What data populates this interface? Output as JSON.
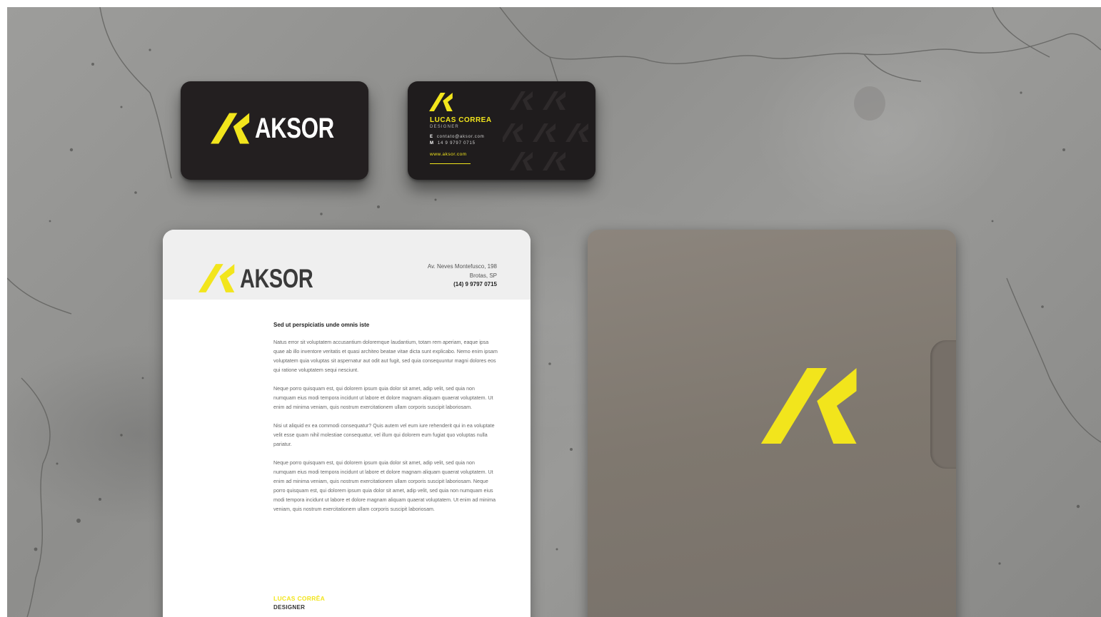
{
  "scene": {
    "background": "concrete-texture",
    "colors": {
      "brand_yellow": "#f2e51c",
      "card_black": "#231f20",
      "folder_taupe": "#7f786f",
      "letterhead_band": "#efefef"
    }
  },
  "business_card_front": {
    "logo_icon": "ak-monogram-icon",
    "wordmark": "AKSOR"
  },
  "business_card_back": {
    "logo_icon": "ak-monogram-icon",
    "name": "LUCAS CORREA",
    "title": "DESIGNER",
    "email_label": "E",
    "email": "contato@aksor.com",
    "mobile_label": "M",
    "mobile": "14 9 9797 0715",
    "website": "www.aksor.com"
  },
  "letterhead": {
    "wordmark": "AKSOR",
    "address_line1": "Av. Neves Montefusco, 198",
    "address_line2": "Brotas, SP",
    "phone": "(14) 9 9797 0715",
    "subject": "Sed ut perspiciatis unde omnis iste",
    "paragraphs": [
      "Natus error sit voluptatem accusantium doloremque laudantium, totam rem aperiam, eaque ipsa quae ab illo inventore veritatis et quasi architeo beatae vitae dicta sunt explicabo. Nemo enim ipsam voluptatem quia voluptas sit aspernatur aut odit aut fugit, sed quia consequuntur magni dolores eos qui ratione voluptatem sequi nesciunt.",
      "Neque porro quisquam est, qui dolorem ipsum quia dolor sit amet, adip velit, sed quia non numquam eius modi tempora incidunt ut labore et dolore magnam aliquam quaerat voluptatem. Ut enim ad minima veniam, quis nostrum exercitationem ullam corporis suscipit laboriosam.",
      "Nisi ut aliquid ex ea commodi consequatur? Quis autem vel eum iure rehenderit qui in ea voluptate velit esse quam nihil molestiae consequatur, vel illum qui dolorem eum fugiat quo voluptas nulla pariatur.",
      "Neque porro quisquam est, qui dolorem ipsum quia dolor sit amet, adip velit, sed quia non numquam eius modi tempora incidunt ut labore et dolore magnam aliquam quaerat voluptatem. Ut enim ad minima veniam, quis nostrum exercitationem ullam corporis suscipit laboriosam. Neque porro quisquam est, qui dolorem ipsum quia dolor sit amet, adip velit, sed quia non numquam eius modi tempora incidunt ut labore et dolore magnam aliquam quaerat voluptatem. Ut enim ad minima veniam, quis nostrum exercitationem ullam corporis suscipit laboriosam."
    ],
    "signature_name": "LUCAS CORRÊA",
    "signature_title": "DESIGNER"
  },
  "folder": {
    "logo_icon": "ak-monogram-icon"
  }
}
